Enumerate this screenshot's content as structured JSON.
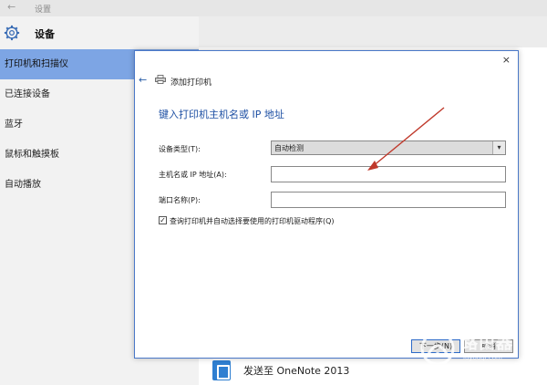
{
  "window": {
    "back_glyph": "←",
    "title": "设置"
  },
  "sidebar": {
    "section_title": "设备",
    "items": [
      {
        "label": "打印机和扫描仪"
      },
      {
        "label": "已连接设备"
      },
      {
        "label": "蓝牙"
      },
      {
        "label": "鼠标和触摸板"
      },
      {
        "label": "自动播放"
      }
    ]
  },
  "content": {
    "onenote_label": "发送至 OneNote 2013"
  },
  "dialog": {
    "close_glyph": "×",
    "back_glyph": "←",
    "title": "添加打印机",
    "heading": "键入打印机主机名或 IP 地址",
    "device_type_label": "设备类型(T):",
    "device_type_value": "自动检测",
    "host_label": "主机名或 IP 地址(A):",
    "host_value": "",
    "port_label": "端口名称(P):",
    "port_value": "",
    "checkbox_checked": true,
    "checkbox_glyph": "✓",
    "checkbox_label": "查询打印机并自动选择要使用的打印机驱动程序(Q)",
    "next_label": "下一步(N)",
    "cancel_label": "取消"
  },
  "watermark": {
    "text": "路由器",
    "subtext": "luyouqi.com"
  },
  "colors": {
    "accent": "#7da5e4",
    "dialog_border": "#4a78c8",
    "heading": "#1d4fa3",
    "arrow": "#c0392b"
  },
  "icons": [
    "back-arrow-icon",
    "gear-icon",
    "printer-icon",
    "close-icon",
    "chevron-down-icon",
    "onenote-icon",
    "checkmark-icon"
  ]
}
